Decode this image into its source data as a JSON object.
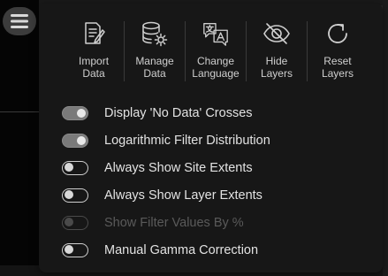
{
  "menu_button": {
    "icon": "hamburger-icon"
  },
  "toolbar": [
    {
      "label_line1": "Import",
      "label_line2": "Data",
      "icon": "import-data-icon"
    },
    {
      "label_line1": "Manage",
      "label_line2": "Data",
      "icon": "database-gear-icon"
    },
    {
      "label_line1": "Change",
      "label_line2": "Language",
      "icon": "translate-icon"
    },
    {
      "label_line1": "Hide",
      "label_line2": "Layers",
      "icon": "eye-slash-icon"
    },
    {
      "label_line1": "Reset",
      "label_line2": "Layers",
      "icon": "reset-icon"
    }
  ],
  "options": [
    {
      "label": "Display 'No Data' Crosses",
      "state": "on",
      "enabled": true
    },
    {
      "label": "Logarithmic Filter Distribution",
      "state": "on",
      "enabled": true
    },
    {
      "label": "Always Show Site Extents",
      "state": "off",
      "enabled": true
    },
    {
      "label": "Always Show Layer Extents",
      "state": "off",
      "enabled": true
    },
    {
      "label": "Show Filter Values By %",
      "state": "off",
      "enabled": false
    },
    {
      "label": "Manual Gamma Correction",
      "state": "off",
      "enabled": true
    }
  ],
  "colors": {
    "panel_bg": "#171717",
    "text": "#e2e2e2",
    "disabled_text": "#5a5a5a",
    "toggle_on": "#7a7a7a"
  }
}
